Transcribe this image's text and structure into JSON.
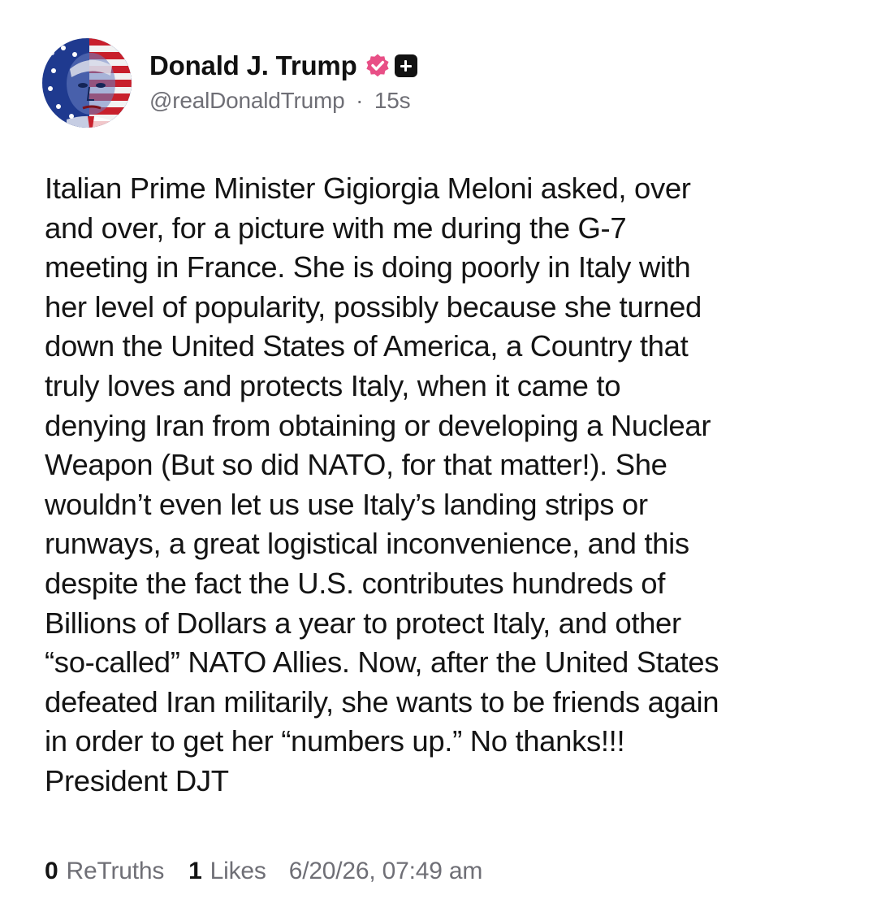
{
  "author": {
    "display_name": "Donald J. Trump",
    "handle": "@realDonaldTrump",
    "separator": "·",
    "relative_time": "15s",
    "avatar_icon": "flag-portrait-avatar",
    "verified_icon": "verified-badge-icon",
    "verified_color": "#e84f86",
    "follow_icon": "plus-icon"
  },
  "post": {
    "text": "Italian Prime Minister Gigiorgia Meloni asked, over\nand over, for a picture with me during the G-7\nmeeting in France. She is doing poorly in Italy with\nher level of popularity, possibly because she turned\ndown the United States of America, a Country that\ntruly loves and protects Italy, when it came to\ndenying Iran from obtaining or developing a Nuclear\nWeapon (But so did NATO, for that matter!). She\nwouldn’t even let us use Italy’s landing strips or\nrunways, a great logistical inconvenience, and this\ndespite the fact the U.S. contributes hundreds of\nBillions of Dollars a year to protect Italy, and other\n“so-called” NATO Allies. Now, after the United States\ndefeated Iran militarily, she wants to be friends again\nin order to get her “numbers up.” No thanks!!!\nPresident DJT"
  },
  "footer": {
    "retruths_count": "0",
    "retruths_label": "ReTruths",
    "likes_count": "1",
    "likes_label": "Likes",
    "timestamp": "6/20/26, 07:49 am"
  }
}
